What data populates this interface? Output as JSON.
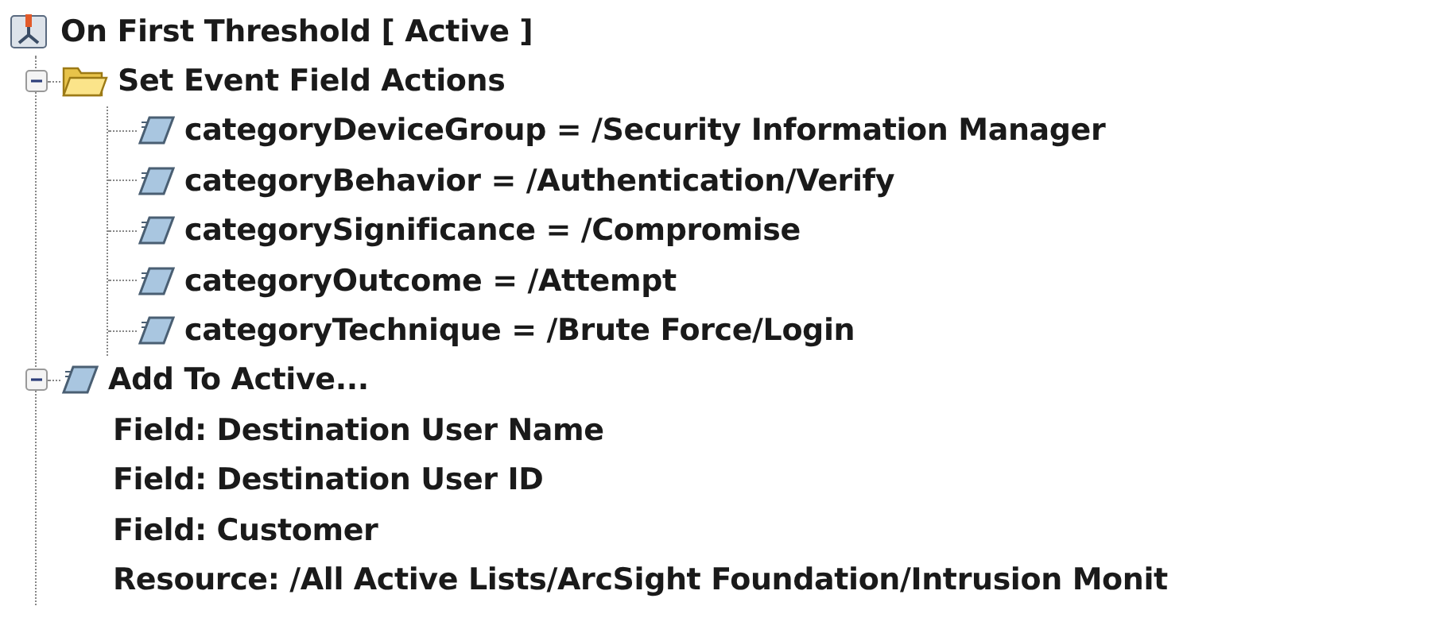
{
  "tree": {
    "label": "On First Threshold [ Active ]",
    "children": [
      {
        "label": "Set Event Field Actions",
        "kind": "folder",
        "expanded": true,
        "children": [
          {
            "label": "categoryDeviceGroup = /Security Information Manager",
            "kind": "field-action"
          },
          {
            "label": "categoryBehavior = /Authentication/Verify",
            "kind": "field-action"
          },
          {
            "label": "categorySignificance = /Compromise",
            "kind": "field-action"
          },
          {
            "label": "categoryOutcome = /Attempt",
            "kind": "field-action"
          },
          {
            "label": "categoryTechnique = /Brute Force/Login",
            "kind": "field-action"
          }
        ]
      },
      {
        "label": "Add To Active...",
        "kind": "action",
        "expanded": true,
        "children": [
          {
            "label": "Field: Destination User Name",
            "kind": "detail"
          },
          {
            "label": "Field: Destination User ID",
            "kind": "detail"
          },
          {
            "label": "Field: Customer",
            "kind": "detail"
          },
          {
            "label": "Resource: /All Active Lists/ArcSight Foundation/Intrusion Monit",
            "kind": "detail"
          }
        ]
      }
    ]
  }
}
